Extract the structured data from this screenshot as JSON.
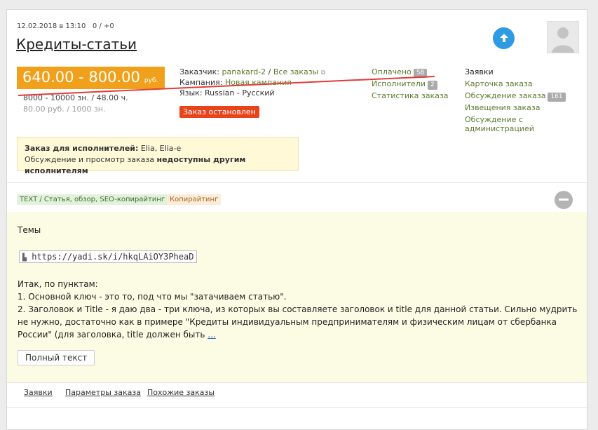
{
  "order": {
    "date": "12.02.2018 в 13:10",
    "counts": "0 / +0",
    "title": "Кредиты-статьи",
    "price_range": "640.00 - 800.00",
    "currency": "руб.",
    "rate_line1": "8000 - 10000 зн.  /  48.00 ч.",
    "rate_line2": "80.00 руб.  /  1000 зн."
  },
  "info": {
    "customer_label": "Заказчик:",
    "customer_name": "panakard-2",
    "all_orders": "Все заказы",
    "campaign_label": "Кампания:",
    "campaign_value": "Новая кампания",
    "language_label": "Язык:",
    "language_value": "Russian - Русский",
    "status_button": "Заказ остановлен"
  },
  "stats": {
    "paid_label": "Оплачено",
    "paid_count": "58",
    "executors_label": "Исполнители",
    "executors_count": "2",
    "statistics_label": "Статистика заказа"
  },
  "links": {
    "requests": "Заявки",
    "order_card": "Карточка заказа",
    "discussion": "Обсуждение заказа",
    "discussion_count": "161",
    "notifications": "Извещения заказа",
    "admin_discussion": "Обсуждение с администрацией"
  },
  "notice": {
    "line1_prefix": "Заказ для исполнителей:",
    "line1_names": "Elia, Elia-e",
    "line2_prefix": "Обсуждение и просмотр заказа",
    "line2_bold": "недоступны другим исполнителям"
  },
  "tags": {
    "category": "TEXT / Статья, обзор, SEO-копирайтинг",
    "type": "Копирайтинг"
  },
  "content": {
    "heading": "Темы",
    "url": "https://yadi.sk/i/hkqLAiOY3PheaD",
    "para1": "Итак, по пунктам:",
    "para2": "1. Основной ключ - это то, под что мы \"затачиваем статью\".",
    "para3": "2. Заголовок и Title - я даю два - три ключа, из которых вы составляете заголовок и title для данной статьи. Сильно мудрить не нужно, достаточно как в примере \"Кредиты индивидуальным предпринимателям и физическим лицам от сбербанка России\" (для заголовка, title должен быть",
    "more": "...",
    "full_text_button": "Полный текст"
  },
  "bottom_tabs": [
    "Заявки",
    "Параметры заказа",
    "Похожие заказы"
  ],
  "icons": {
    "up": "arrow-up-icon",
    "avatar": "user-avatar-icon",
    "settings": "gear-icon",
    "external": "external-link-icon",
    "file": "file-icon"
  },
  "colors": {
    "price": "#f0a01b",
    "stop": "#e8431b",
    "link": "#5a7a2e",
    "upbtn": "#2e9be2"
  }
}
